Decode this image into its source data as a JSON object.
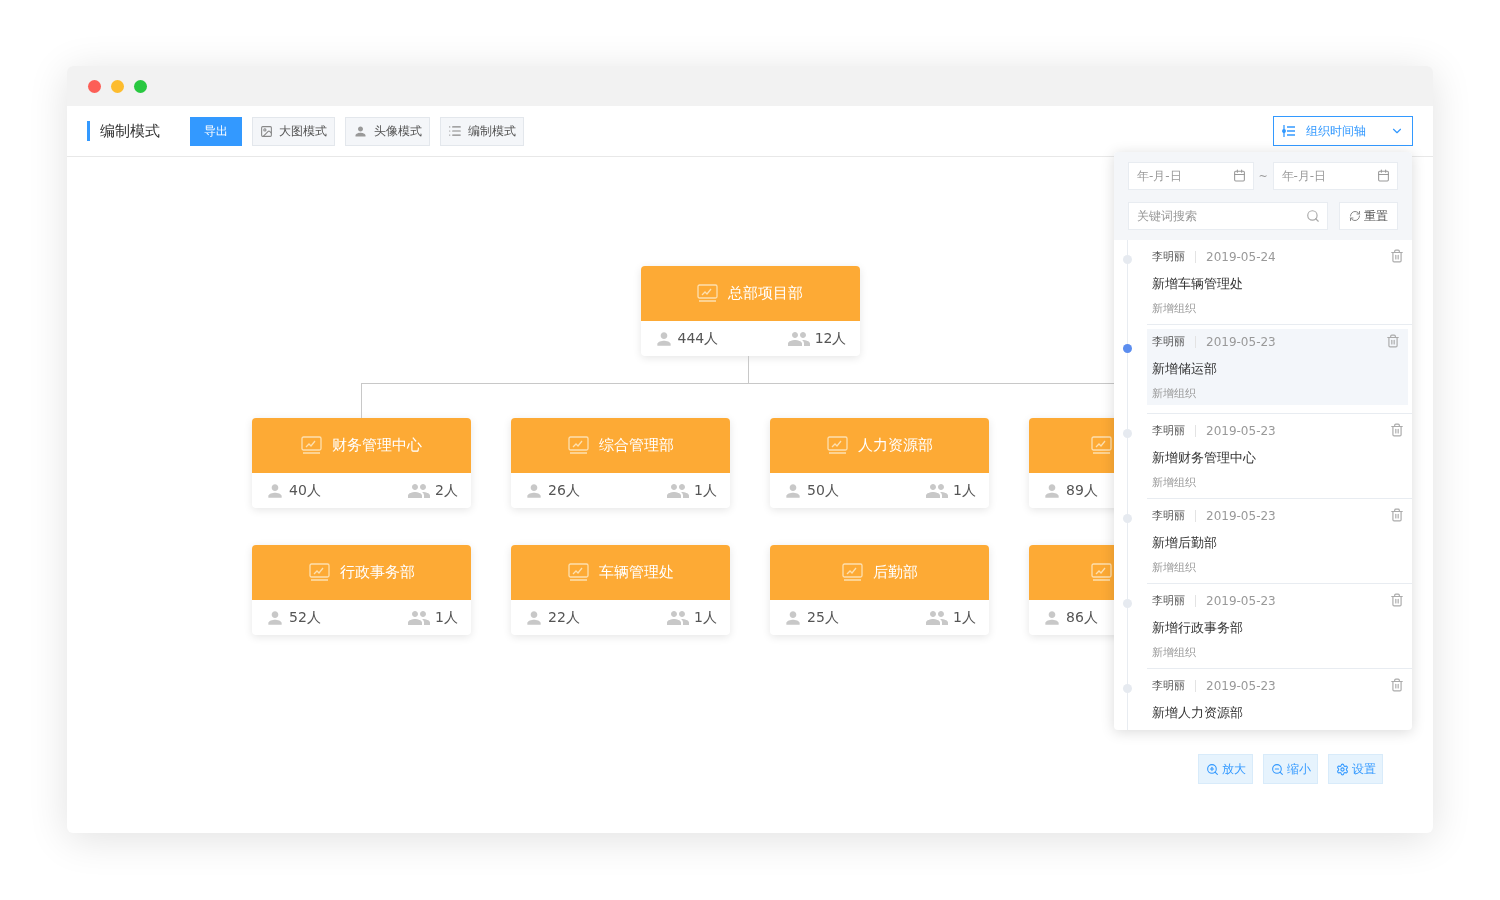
{
  "window": {
    "controls": [
      {
        "color": "#fc5f57"
      },
      {
        "color": "#fdbc2e"
      },
      {
        "color": "#28c840"
      }
    ]
  },
  "toolbar": {
    "title": "编制模式",
    "buttons": [
      {
        "label": "导出",
        "kind": "primary"
      },
      {
        "label": "大图模式",
        "kind": "image"
      },
      {
        "label": "头像模式",
        "kind": "avatar"
      },
      {
        "label": "编制模式",
        "kind": "list"
      }
    ]
  },
  "timeline_toggle": {
    "label": "组织时间轴",
    "expanded": true
  },
  "org_chart": {
    "root": {
      "name": "总部项目部",
      "members": "444人",
      "groups": "12人"
    },
    "rows": [
      [
        {
          "name": "财务管理中心",
          "members": "40人",
          "groups": "2人"
        },
        {
          "name": "综合管理部",
          "members": "26人",
          "groups": "1人"
        },
        {
          "name": "人力资源部",
          "members": "50人",
          "groups": "1人"
        },
        {
          "members": "89人"
        }
      ],
      [
        {
          "name": "行政事务部",
          "members": "52人",
          "groups": "1人"
        },
        {
          "name": "车辆管理处",
          "members": "22人",
          "groups": "1人"
        },
        {
          "name": "后勤部",
          "members": "25人",
          "groups": "1人"
        },
        {
          "members": "86人"
        }
      ]
    ]
  },
  "timeline_panel": {
    "date_from": {
      "placeholder": "年-月-日"
    },
    "separator": "~",
    "date_to": {
      "placeholder": "年-月-日"
    },
    "search": {
      "placeholder": "关键词搜索"
    },
    "reset": "重置",
    "entries": [
      {
        "user": "李明丽",
        "date": "2019-05-24",
        "title": "新增车辆管理处",
        "subtitle": "新增组织",
        "selected": false
      },
      {
        "user": "李明丽",
        "date": "2019-05-23",
        "title": "新增储运部",
        "subtitle": "新增组织",
        "selected": true
      },
      {
        "user": "李明丽",
        "date": "2019-05-23",
        "title": "新增财务管理中心",
        "subtitle": "新增组织",
        "selected": false
      },
      {
        "user": "李明丽",
        "date": "2019-05-23",
        "title": "新增后勤部",
        "subtitle": "新增组织",
        "selected": false
      },
      {
        "user": "李明丽",
        "date": "2019-05-23",
        "title": "新增行政事务部",
        "subtitle": "新增组织",
        "selected": false
      },
      {
        "user": "李明丽",
        "date": "2019-05-23",
        "title": "新增人力资源部",
        "selected": false
      }
    ]
  },
  "zoom_controls": [
    {
      "label": "放大",
      "kind": "zoom_in"
    },
    {
      "label": "缩小",
      "kind": "zoom_out"
    },
    {
      "label": "设置",
      "kind": "settings"
    }
  ]
}
